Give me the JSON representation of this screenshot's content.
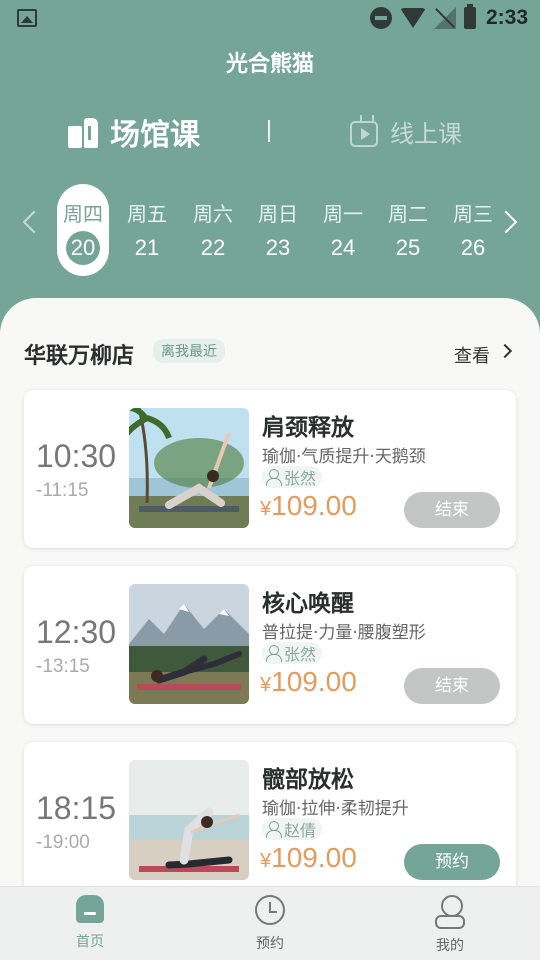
{
  "status_bar": {
    "time": "2:33"
  },
  "app": {
    "title": "光合熊猫"
  },
  "mode_tabs": {
    "venue_label": "场馆课",
    "online_label": "线上课"
  },
  "dates": [
    {
      "weekday": "周四",
      "day": "20",
      "selected": true
    },
    {
      "weekday": "周五",
      "day": "21"
    },
    {
      "weekday": "周六",
      "day": "22"
    },
    {
      "weekday": "周日",
      "day": "23"
    },
    {
      "weekday": "周一",
      "day": "24"
    },
    {
      "weekday": "周二",
      "day": "25"
    },
    {
      "weekday": "周三",
      "day": "26"
    }
  ],
  "store": {
    "name": "华联万柳店",
    "badge": "离我最近",
    "view_label": "查看"
  },
  "courses": [
    {
      "start": "10:30",
      "end": "-11:15",
      "title": "肩颈释放",
      "tags": "瑜伽·气质提升·天鹅颈",
      "coach": "张然",
      "currency": "¥",
      "price": "109.00",
      "action": "结束",
      "action_state": "ended"
    },
    {
      "start": "12:30",
      "end": "-13:15",
      "title": "核心唤醒",
      "tags": "普拉提·力量·腰腹塑形",
      "coach": "张然",
      "currency": "¥",
      "price": "109.00",
      "action": "结束",
      "action_state": "ended"
    },
    {
      "start": "18:15",
      "end": "-19:00",
      "title": "髋部放松",
      "tags": "瑜伽·拉伸·柔韧提升",
      "coach": "赵倩",
      "currency": "¥",
      "price": "109.00",
      "action": "预约",
      "action_state": "book"
    }
  ],
  "bottom_nav": {
    "home": "首页",
    "booking": "预约",
    "mine": "我的"
  },
  "colors": {
    "primary": "#74a597",
    "price": "#e59a5e",
    "ended": "#c3c6c4"
  },
  "icons": [
    "image-icon",
    "dnd-icon",
    "wifi-icon",
    "signal-icon",
    "battery-icon",
    "building-icon",
    "tv-play-icon",
    "chevron-left-icon",
    "chevron-right-icon",
    "person-icon",
    "home-icon",
    "clock-icon",
    "profile-icon"
  ]
}
